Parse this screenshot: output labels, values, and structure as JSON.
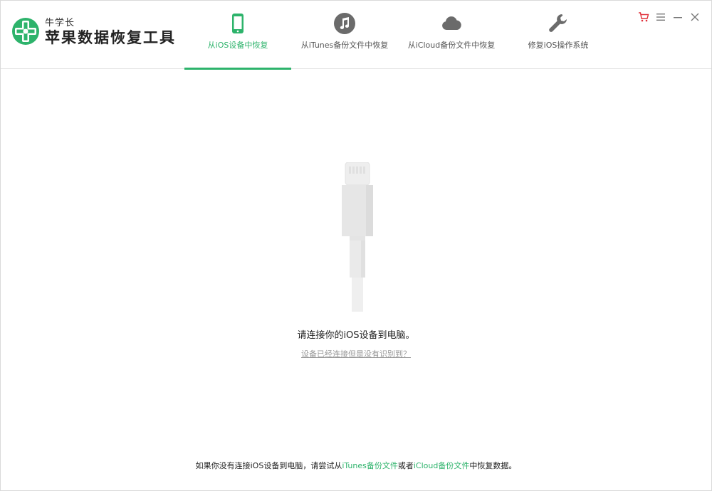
{
  "brand": {
    "small": "牛学长",
    "name": "苹果数据恢复工具"
  },
  "tabs": [
    {
      "label": "从iOS设备中恢复",
      "icon": "phone-icon",
      "active": true
    },
    {
      "label": "从iTunes备份文件中恢复",
      "icon": "music-note-icon",
      "active": false
    },
    {
      "label": "从iCloud备份文件中恢复",
      "icon": "cloud-icon",
      "active": false
    },
    {
      "label": "修复iOS操作系统",
      "icon": "wrench-icon",
      "active": false
    }
  ],
  "window_controls": [
    "cart-icon",
    "menu-icon",
    "minimize-icon",
    "close-icon"
  ],
  "main": {
    "connect_text": "请连接你的iOS设备到电脑。",
    "help_link": "设备已经连接但是没有识别到？"
  },
  "footer": {
    "prefix": "如果你没有连接iOS设备到电脑，请尝试从",
    "itunes_link": "iTunes备份文件",
    "middle": "或者",
    "icloud_link": "iCloud备份文件",
    "suffix": "中恢复数据。"
  },
  "colors": {
    "accent": "#2db36b",
    "icon_gray": "#6b6b6b",
    "cart_red": "#e0303a"
  }
}
